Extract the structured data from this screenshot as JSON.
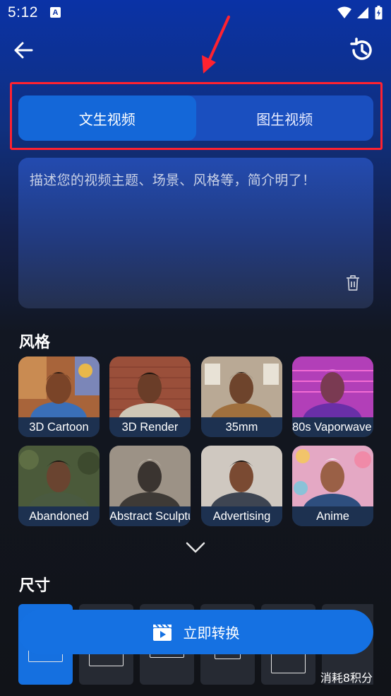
{
  "status_bar": {
    "time": "5:12",
    "notification_letter": "A"
  },
  "header": {
    "back_icon": "arrow-left-icon",
    "history_icon": "history-clock-icon"
  },
  "tabs": [
    {
      "label": "文生视频",
      "active": true
    },
    {
      "label": "图生视频",
      "active": false
    }
  ],
  "prompt": {
    "placeholder": "描述您的视频主题、场景、风格等，简介明了！"
  },
  "style_section": {
    "title": "风格",
    "styles": [
      {
        "label": "3D Cartoon"
      },
      {
        "label": "3D Render"
      },
      {
        "label": "35mm"
      },
      {
        "label": "80s Vaporwave"
      },
      {
        "label": "Abandoned"
      },
      {
        "label": "Abstract Sculpture"
      },
      {
        "label": "Advertising"
      },
      {
        "label": "Anime"
      }
    ]
  },
  "size_section": {
    "title": "尺寸"
  },
  "action": {
    "convert_label": "立即转换",
    "cost_text": "消耗8积分"
  },
  "colors": {
    "accent": "#1571e2",
    "highlight": "#ff2230"
  }
}
